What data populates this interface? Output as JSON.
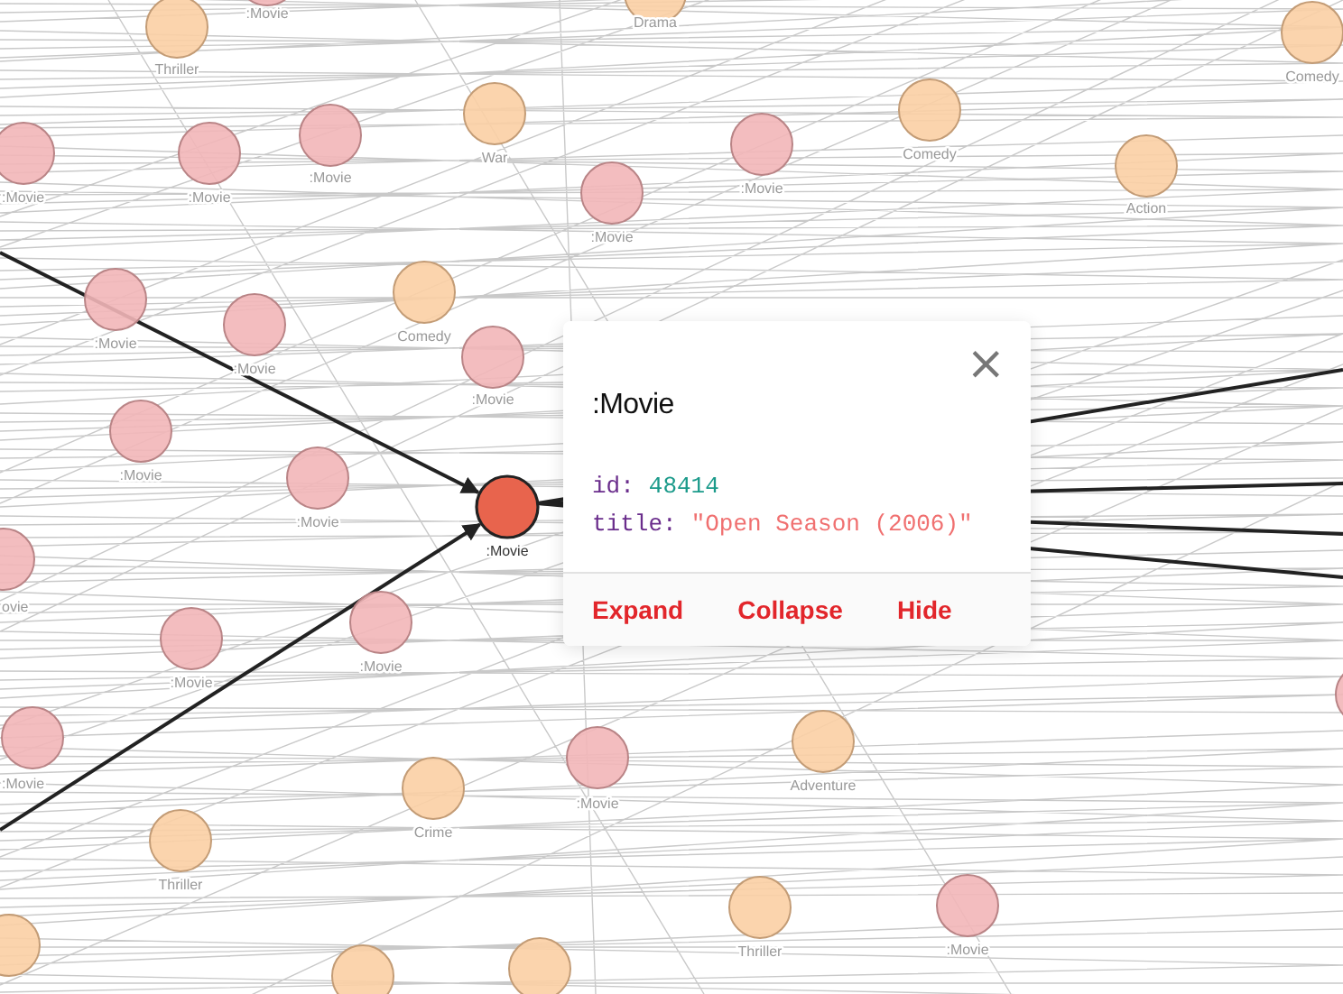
{
  "graph": {
    "nodes": [
      {
        "kind": "genre",
        "label": "Thriller",
        "selected": false
      },
      {
        "kind": "movie",
        "label": ":Movie",
        "selected": false
      },
      {
        "kind": "genre",
        "label": "Drama",
        "selected": false
      },
      {
        "kind": "genre",
        "label": "Comedy",
        "selected": false
      },
      {
        "kind": "movie",
        "label": ":Movie",
        "selected": false
      },
      {
        "kind": "movie",
        "label": ":Movie",
        "selected": false
      },
      {
        "kind": "movie",
        "label": ":Movie",
        "selected": false
      },
      {
        "kind": "genre",
        "label": "War",
        "selected": false
      },
      {
        "kind": "movie",
        "label": ":Movie",
        "selected": false
      },
      {
        "kind": "movie",
        "label": ":Movie",
        "selected": false
      },
      {
        "kind": "genre",
        "label": "Comedy",
        "selected": false
      },
      {
        "kind": "genre",
        "label": "Action",
        "selected": false
      },
      {
        "kind": "movie",
        "label": ":Movie",
        "selected": false
      },
      {
        "kind": "movie",
        "label": ":Movie",
        "selected": false
      },
      {
        "kind": "genre",
        "label": "Comedy",
        "selected": false
      },
      {
        "kind": "movie",
        "label": ":Movie",
        "selected": false
      },
      {
        "kind": "movie",
        "label": ":Movie",
        "selected": false
      },
      {
        "kind": "movie",
        "label": ":Movie",
        "selected": false
      },
      {
        "kind": "movie",
        "label": ":Movie",
        "selected": true
      },
      {
        "kind": "movie",
        "label": "ovie",
        "selected": false
      },
      {
        "kind": "movie",
        "label": ":Movie",
        "selected": false
      },
      {
        "kind": "movie",
        "label": ":Movie",
        "selected": false
      },
      {
        "kind": "movie",
        "label": ":Movie",
        "selected": false
      },
      {
        "kind": "genre",
        "label": "Thriller",
        "selected": false
      },
      {
        "kind": "genre",
        "label": "Crime",
        "selected": false
      },
      {
        "kind": "movie",
        "label": ":Movie",
        "selected": false
      },
      {
        "kind": "genre",
        "label": "Adventure",
        "selected": false
      },
      {
        "kind": "genre",
        "label": "Thriller",
        "selected": false
      },
      {
        "kind": "movie",
        "label": ":Movie",
        "selected": false
      },
      {
        "kind": "movie",
        "selected": false
      },
      {
        "kind": "genre",
        "selected": false
      },
      {
        "kind": "genre",
        "selected": false
      },
      {
        "kind": "genre",
        "selected": false
      }
    ]
  },
  "inspector": {
    "title": ":Movie",
    "properties": [
      {
        "key": "id:",
        "value": "48414",
        "kind": "number"
      },
      {
        "key": "title:",
        "value": "\"Open Season (2006)\"",
        "kind": "string"
      }
    ],
    "actions": [
      "Expand",
      "Collapse",
      "Hide"
    ],
    "close": "×"
  }
}
